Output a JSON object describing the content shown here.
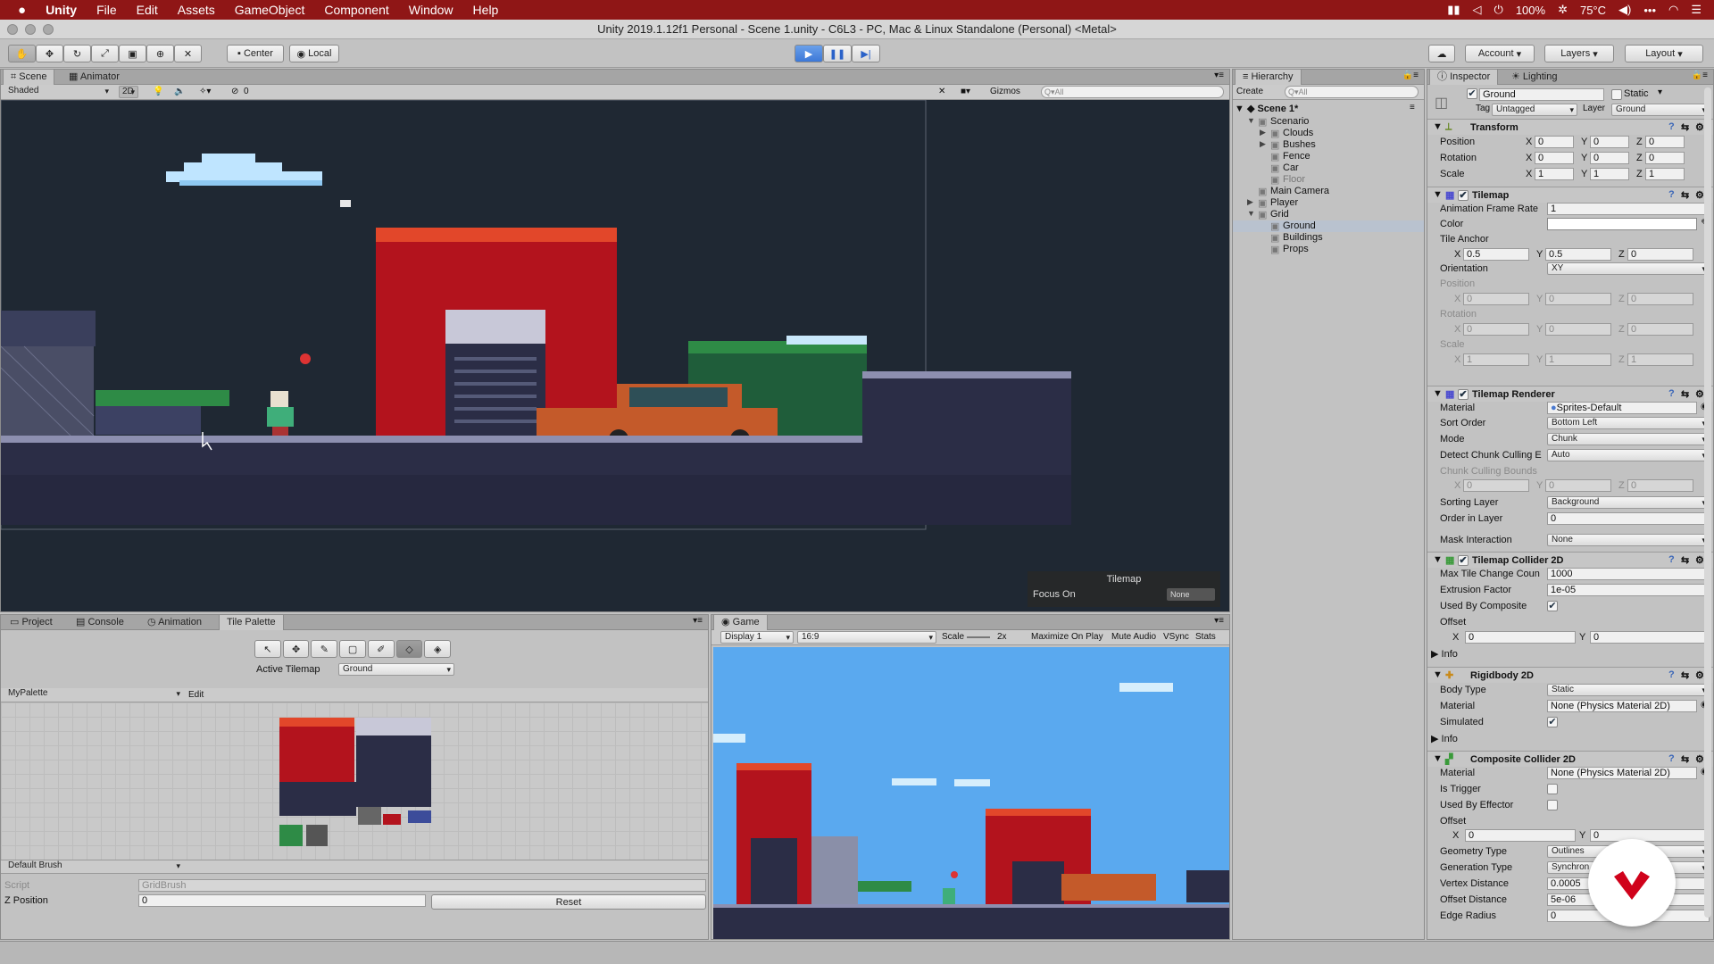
{
  "menubar": {
    "app": "Unity",
    "items": [
      "File",
      "Edit",
      "Assets",
      "GameObject",
      "Component",
      "Window",
      "Help"
    ],
    "battery": "100%",
    "temperature": "75°C"
  },
  "window": {
    "title": "Unity 2019.1.12f1 Personal - Scene 1.unity - C6L3 - PC, Mac & Linux Standalone (Personal) <Metal>"
  },
  "toolbar": {
    "pivot": "Center",
    "space": "Local",
    "account": "Account",
    "layers": "Layers",
    "layout": "Layout"
  },
  "scene": {
    "tabs": [
      "Scene",
      "Animator"
    ],
    "shading": "Shaded",
    "mode2d": "2D",
    "fx_count": "0",
    "gizmos": "Gizmos",
    "search_placeholder": "Q▾All",
    "overlay_title": "Tilemap",
    "overlay_focus_label": "Focus On",
    "overlay_focus_value": "None"
  },
  "hierarchy": {
    "tab": "Hierarchy",
    "create": "Create",
    "search_placeholder": "Q▾All",
    "scene_name": "Scene 1*",
    "items": [
      {
        "label": "Scenario",
        "depth": 1,
        "arrow": "▼"
      },
      {
        "label": "Clouds",
        "depth": 2,
        "arrow": "▶"
      },
      {
        "label": "Bushes",
        "depth": 2,
        "arrow": "▶"
      },
      {
        "label": "Fence",
        "depth": 2,
        "arrow": ""
      },
      {
        "label": "Car",
        "depth": 2,
        "arrow": ""
      },
      {
        "label": "Floor",
        "depth": 2,
        "arrow": ""
      },
      {
        "label": "Main Camera",
        "depth": 1,
        "arrow": ""
      },
      {
        "label": "Player",
        "depth": 1,
        "arrow": "▶"
      },
      {
        "label": "Grid",
        "depth": 1,
        "arrow": "▼"
      },
      {
        "label": "Ground",
        "depth": 2,
        "arrow": ""
      },
      {
        "label": "Buildings",
        "depth": 2,
        "arrow": ""
      },
      {
        "label": "Props",
        "depth": 2,
        "arrow": ""
      }
    ]
  },
  "inspector": {
    "tabs": [
      "Inspector",
      "Lighting"
    ],
    "object_name": "Ground",
    "static_label": "Static",
    "tag_label": "Tag",
    "tag_value": "Untagged",
    "layer_label": "Layer",
    "layer_value": "Ground",
    "transform": {
      "title": "Transform",
      "position_label": "Position",
      "rotation_label": "Rotation",
      "scale_label": "Scale",
      "position": [
        "0",
        "0",
        "0"
      ],
      "rotation": [
        "0",
        "0",
        "0"
      ],
      "scale": [
        "1",
        "1",
        "1"
      ]
    },
    "tilemap": {
      "title": "Tilemap",
      "anim_rate_label": "Animation Frame Rate",
      "anim_rate": "1",
      "color_label": "Color",
      "tile_anchor_label": "Tile Anchor",
      "tile_anchor": [
        "0.5",
        "0.5",
        "0"
      ],
      "orientation_label": "Orientation",
      "orientation": "XY",
      "position_label": "Position",
      "position": [
        "0",
        "0",
        "0"
      ],
      "rotation_label": "Rotation",
      "rotation": [
        "0",
        "0",
        "0"
      ],
      "scale_label": "Scale",
      "scale": [
        "1",
        "1",
        "1"
      ]
    },
    "renderer": {
      "title": "Tilemap Renderer",
      "material_label": "Material",
      "material": "Sprites-Default",
      "sort_order_label": "Sort Order",
      "sort_order": "Bottom Left",
      "mode_label": "Mode",
      "mode": "Chunk",
      "detect_label": "Detect Chunk Culling E",
      "detect": "Auto",
      "bounds_label": "Chunk Culling Bounds",
      "bounds": [
        "0",
        "0",
        "0"
      ],
      "sorting_layer_label": "Sorting Layer",
      "sorting_layer": "Background",
      "order_label": "Order in Layer",
      "order": "0",
      "mask_label": "Mask Interaction",
      "mask": "None"
    },
    "collider": {
      "title": "Tilemap Collider 2D",
      "max_tile_label": "Max Tile Change Coun",
      "max_tile": "1000",
      "extrusion_label": "Extrusion Factor",
      "extrusion": "1e-05",
      "composite_label": "Used By Composite",
      "offset_label": "Offset",
      "offset": [
        "0",
        "0"
      ],
      "info": "Info"
    },
    "rigidbody": {
      "title": "Rigidbody 2D",
      "body_type_label": "Body Type",
      "body_type": "Static",
      "material_label": "Material",
      "material": "None (Physics Material 2D)",
      "simulated_label": "Simulated",
      "info": "Info"
    },
    "composite": {
      "title": "Composite Collider 2D",
      "material_label": "Material",
      "material": "None (Physics Material 2D)",
      "trigger_label": "Is Trigger",
      "effector_label": "Used By Effector",
      "offset_label": "Offset",
      "offset": [
        "0",
        "0"
      ],
      "geometry_label": "Geometry Type",
      "geometry": "Outlines",
      "generation_label": "Generation Type",
      "generation": "Synchron",
      "vertex_label": "Vertex Distance",
      "vertex": "0.0005",
      "offset_dist_label": "Offset Distance",
      "offset_dist": "5e-06",
      "edge_label": "Edge Radius",
      "edge": "0"
    }
  },
  "bottom": {
    "tabs": [
      "Project",
      "Console",
      "Animation",
      "Tile Palette"
    ],
    "active_tilemap_label": "Active Tilemap",
    "active_tilemap": "Ground",
    "palette": "MyPalette",
    "edit": "Edit",
    "brush": "Default Brush",
    "script_label": "Script",
    "script": "GridBrush",
    "zpos_label": "Z Position",
    "zpos": "0",
    "reset": "Reset"
  },
  "game": {
    "tab": "Game",
    "display": "Display 1",
    "aspect": "16:9",
    "scale_label": "Scale",
    "scale_value": "2x",
    "maximize": "Maximize On Play",
    "mute": "Mute Audio",
    "vsync": "VSync",
    "stats": "Stats"
  },
  "colors": {
    "menubar": "#8f1616",
    "scene_bg": "#1f2833",
    "game_sky": "#5aa9ef",
    "building_red": "#b3131d",
    "roof_orange": "#e2472a",
    "car_orange": "#c45a2a",
    "ground_dark": "#2b2d46",
    "grass_green": "#2e8b46",
    "selection": "#b9c2cf",
    "badge_red": "#d0021b"
  }
}
